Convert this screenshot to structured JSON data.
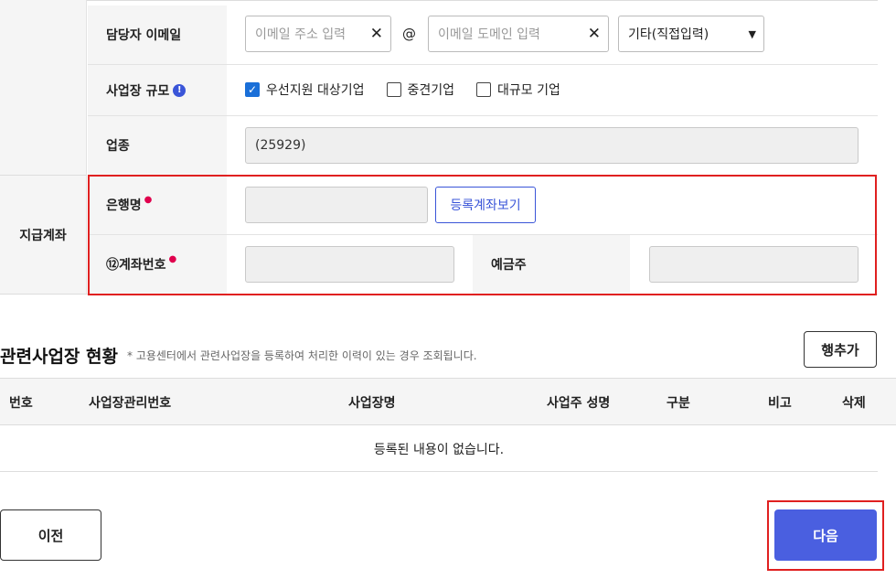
{
  "form": {
    "email": {
      "label": "담당자 이메일",
      "local_placeholder": "이메일 주소 입력",
      "at": "@",
      "domain_placeholder": "이메일 도메인 입력",
      "domain_select": "기타(직접입력)"
    },
    "scale": {
      "label": "사업장 규모",
      "options": [
        {
          "label": "우선지원 대상기업",
          "checked": true
        },
        {
          "label": "중견기업",
          "checked": false
        },
        {
          "label": "대규모 기업",
          "checked": false
        }
      ]
    },
    "industry": {
      "label": "업종",
      "value": "(25929)"
    },
    "payment": {
      "section_label": "지급계좌",
      "bank_label": "은행명",
      "required_mark": "●",
      "view_accounts_button": "등록계좌보기",
      "account_label": "⑫계좌번호",
      "holder_label": "예금주"
    }
  },
  "related": {
    "title": "관련사업장 현황",
    "note": "* 고용센터에서 관련사업장을 등록하여 처리한 이력이 있는 경우 조회됩니다.",
    "add_row_button": "행추가",
    "columns": [
      "번호",
      "사업장관리번호",
      "사업장명",
      "사업주 성명",
      "구분",
      "비고",
      "삭제"
    ],
    "empty_message": "등록된 내용이 없습니다."
  },
  "footer": {
    "prev_button": "이전",
    "next_button": "다음"
  },
  "colors": {
    "accent": "#4a5fe0",
    "required": "#e0004d",
    "highlight": "#e02020"
  }
}
